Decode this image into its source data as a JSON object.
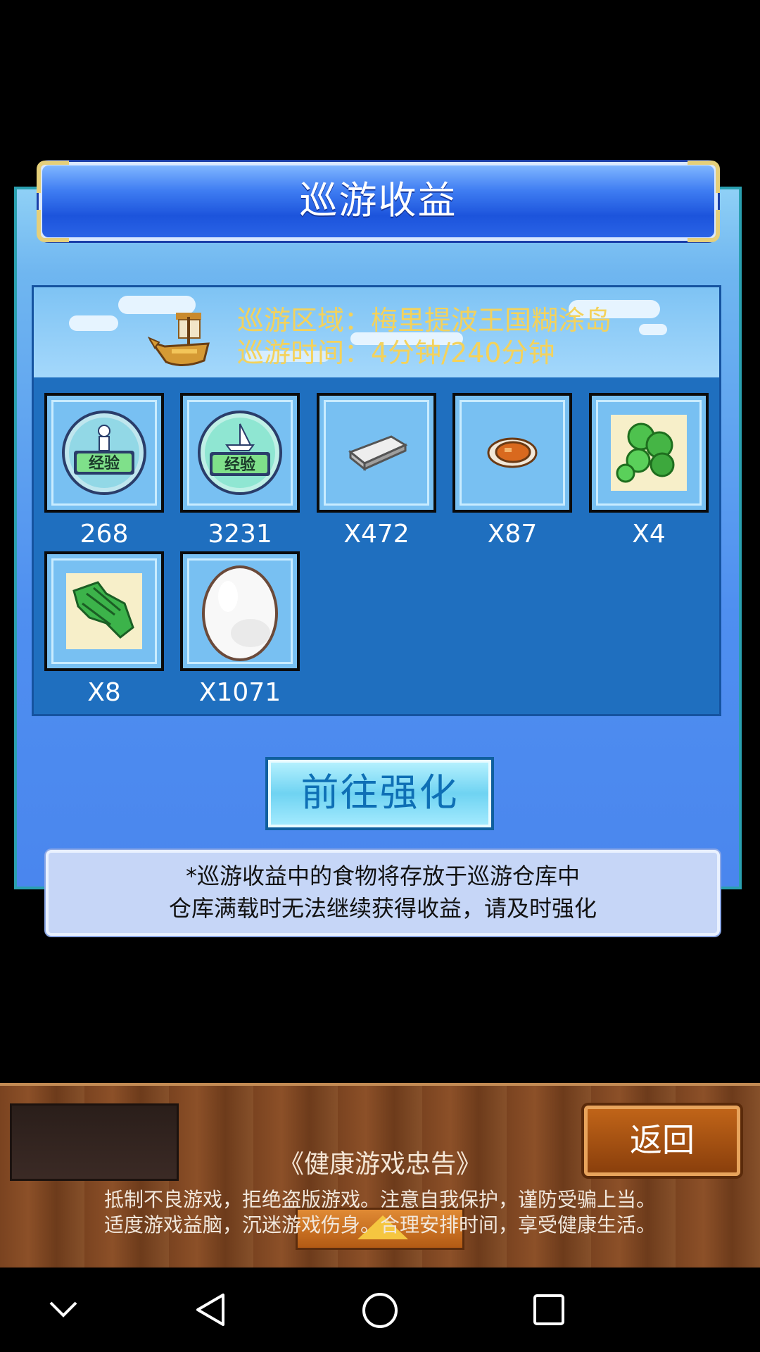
{
  "dialog": {
    "title": "巡游收益",
    "area_line": "巡游区域：梅里提波王国糊涂岛",
    "time_line": "巡游时间：4分钟/240分钟"
  },
  "rewards": [
    {
      "icon": "person-experience-icon",
      "count": "268"
    },
    {
      "icon": "ship-experience-icon",
      "count": "3231"
    },
    {
      "icon": "silver-ingot-icon",
      "count": "X472"
    },
    {
      "icon": "roast-meat-icon",
      "count": "X87"
    },
    {
      "icon": "green-peas-icon",
      "count": "X4"
    },
    {
      "icon": "green-leaves-icon",
      "count": "X8"
    },
    {
      "icon": "egg-icon",
      "count": "X1071"
    }
  ],
  "experience_badge": "经验",
  "upgrade_button": "前往强化",
  "notice": {
    "line1": "*巡游收益中的食物将存放于巡游仓库中",
    "line2": "仓库满载时无法继续获得收益，请及时强化"
  },
  "footer": {
    "back_button": "返回",
    "health_title": "《健康游戏忠告》",
    "health_line1": "抵制不良游戏，拒绝盗版游戏。注意自我保护，谨防受骗上当。",
    "health_line2": "适度游戏益脑，沉迷游戏伤身。合理安排时间，享受健康生活。"
  },
  "navbar": {
    "icons": [
      "chevron-down-icon",
      "back-triangle-icon",
      "home-circle-icon",
      "recents-square-icon"
    ]
  },
  "colors": {
    "accent_gold": "#f4d25b",
    "panel_blue": "#4a86ee",
    "button_text": "#0e6fb5"
  }
}
